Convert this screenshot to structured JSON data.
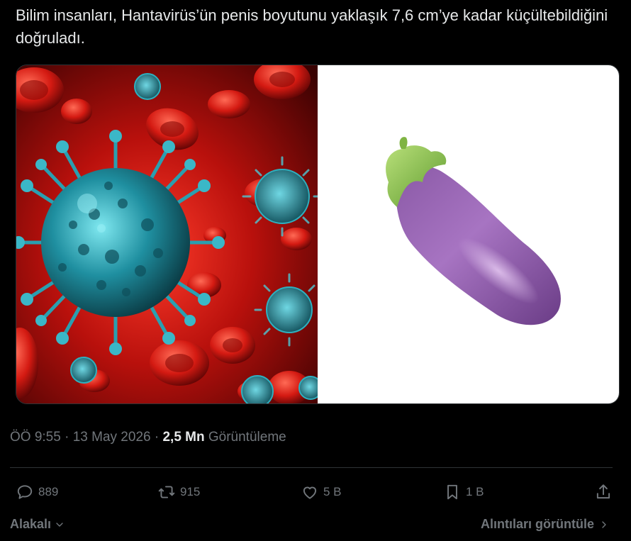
{
  "tweet": {
    "text": "Bilim insanları, Hantavirüs’ün penis boyutunu yaklaşık 7,6 cm’ye kadar küçültebildiğini doğruladı."
  },
  "media": {
    "left_image": "virus-and-red-blood-cells-illustration",
    "right_image": "eggplant-emoji"
  },
  "meta": {
    "time": "ÖÖ 9:55",
    "separator1": "·",
    "date": "13 May 2026",
    "separator2": "·",
    "views_count": "2,5 Mn",
    "views_label": "Görüntüleme"
  },
  "actions": {
    "replies": "889",
    "reposts": "915",
    "likes": "5 B",
    "bookmarks": "1 B"
  },
  "footer": {
    "sort_label": "Alakalı",
    "quotes_label": "Alıntıları görüntüle"
  },
  "colors": {
    "background": "#000000",
    "text": "#e7e9ea",
    "muted": "#71767b",
    "divider": "#2f3336"
  }
}
